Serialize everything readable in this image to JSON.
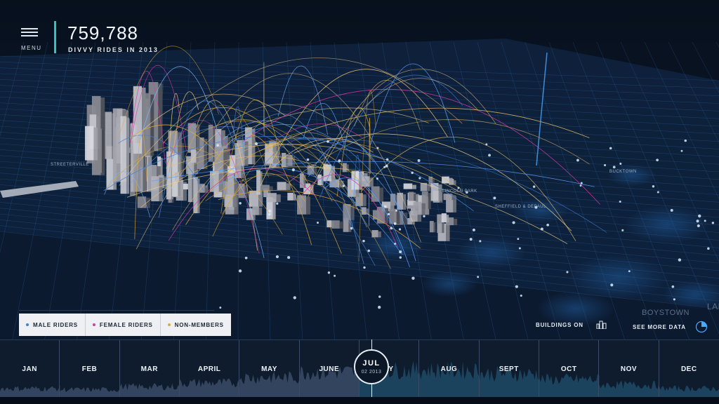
{
  "header": {
    "menu_label": "MENU",
    "ride_count": "759,788",
    "subtitle": "DIVVY RIDES IN 2013"
  },
  "legend": {
    "items": [
      {
        "label": "MALE RIDERS",
        "color": "#3f7fd9"
      },
      {
        "label": "FEMALE RIDERS",
        "color": "#d83aa8"
      },
      {
        "label": "NON-MEMBERS",
        "color": "#e0a93a"
      }
    ]
  },
  "controls": {
    "buildings_label": "BUILDINGS ON",
    "see_more_label": "SEE MORE DATA"
  },
  "map_labels": [
    "STREETERVILLE",
    "LINCOLN PARK",
    "SHEFFIELD & DEPAUL",
    "BUCKTOWN",
    "BOYSTOWN",
    "LAK"
  ],
  "timeline": {
    "months": [
      "JAN",
      "FEB",
      "MAR",
      "APRIL",
      "MAY",
      "JUNE",
      "LY",
      "AUG",
      "SEPT",
      "OCT",
      "NOV",
      "DEC"
    ],
    "current_month": "JUL",
    "current_date": "02 2013"
  },
  "colors": {
    "accent": "#2ec4c0",
    "background": "#0a1424"
  }
}
